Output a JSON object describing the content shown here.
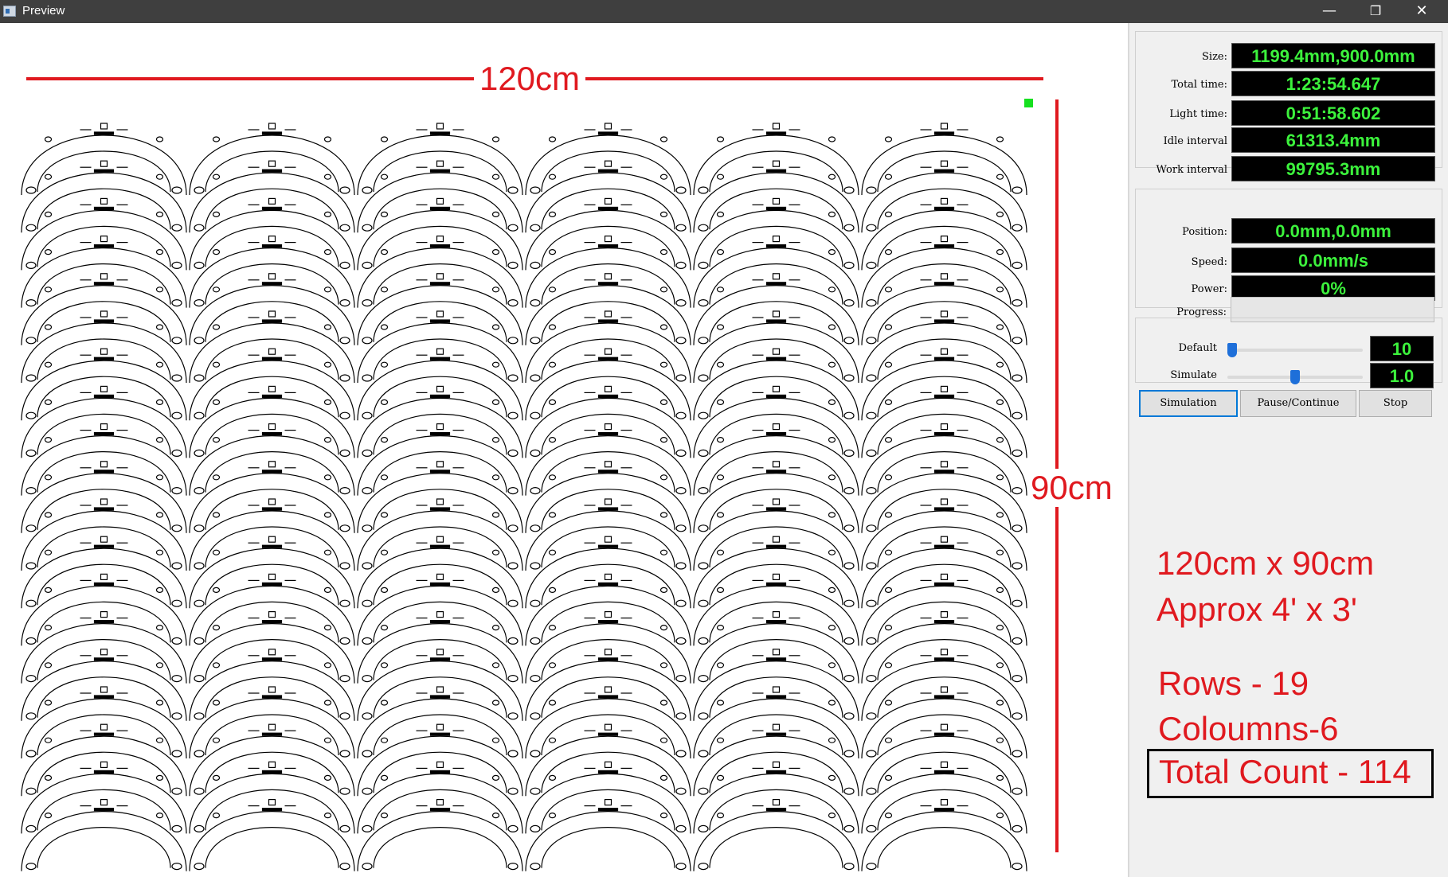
{
  "window": {
    "title": "Preview",
    "min_glyph": "—",
    "max_glyph": "❐",
    "close_glyph": "✕"
  },
  "canvas": {
    "width_label": "120cm",
    "height_label": "90cm",
    "colors": {
      "dimension_lines": "#e0191f",
      "origin_marker": "#16e01f",
      "parts": "#000000"
    }
  },
  "stats": {
    "size": {
      "label": "Size:",
      "value": "1199.4mm,900.0mm"
    },
    "total_time": {
      "label": "Total time:",
      "value": "1:23:54.647"
    },
    "light_time": {
      "label": "Light time:",
      "value": "0:51:58.602"
    },
    "idle_interval": {
      "label": "Idle interval",
      "value": "61313.4mm"
    },
    "work_interval": {
      "label": "Work interval",
      "value": "99795.3mm"
    }
  },
  "status": {
    "position": {
      "label": "Position:",
      "value": "0.0mm,0.0mm"
    },
    "speed": {
      "label": "Speed:",
      "value": "0.0mm/s"
    },
    "power": {
      "label": "Power:",
      "value": "0%"
    },
    "progress": {
      "label": "Progress:",
      "value": 0
    }
  },
  "speed_controls": {
    "default": {
      "label": "Default",
      "value": "10",
      "level": 0.0
    },
    "simulate": {
      "label": "Simulate",
      "value": "1.0",
      "level": 0.5
    }
  },
  "buttons": {
    "simulation": "Simulation",
    "pause_continue": "Pause/Continue",
    "stop": "Stop"
  },
  "notes": {
    "line1": "120cm x 90cm",
    "line2": "Approx 4' x 3'",
    "rows": "Rows - 19",
    "columns": "Coloumns-6",
    "total": "Total Count - 114"
  },
  "layout_grid": {
    "rows": 19,
    "columns": 6
  }
}
